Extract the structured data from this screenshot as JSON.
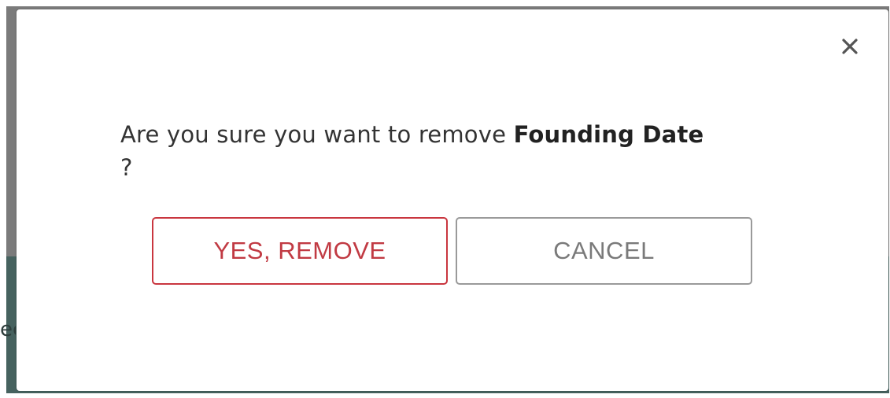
{
  "dialog": {
    "message_prefix": "Are you sure you want to remove",
    "item_name": "Founding Date",
    "message_suffix": "?",
    "confirm_label": "YES, REMOVE",
    "cancel_label": "CANCEL",
    "close_icon": "close-icon"
  },
  "background": {
    "partial_text": "ec"
  },
  "colors": {
    "danger": "#c9363f",
    "neutral": "#9a9a9a",
    "overlay_top": "#7b7b7b",
    "overlay_bottom": "#46625f"
  }
}
